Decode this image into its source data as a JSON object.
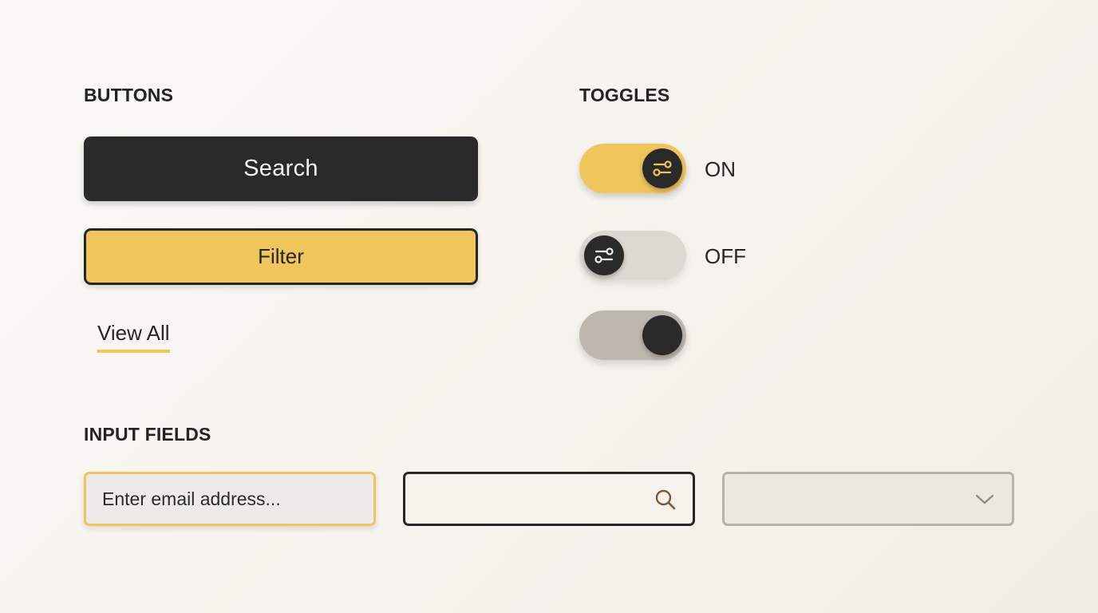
{
  "sections": {
    "buttons_title": "BUTTONS",
    "toggles_title": "TOGGLES",
    "inputs_title": "INPUT FIELDS"
  },
  "buttons": {
    "search_label": "Search",
    "filter_label": "Filter",
    "view_all_label": "View All"
  },
  "toggles": [
    {
      "state": "on",
      "label": "ON",
      "icon": "sliders-icon"
    },
    {
      "state": "off",
      "label": "OFF",
      "icon": "sliders-icon"
    },
    {
      "state": "on",
      "label": ""
    }
  ],
  "inputs": {
    "email_placeholder": "Enter email address...",
    "email_value": "",
    "search_value": "",
    "search_icon": "search-icon",
    "select_value": "",
    "select_icon": "chevron-down-icon"
  },
  "colors": {
    "accent_yellow": "#efc55c",
    "dark": "#2a2a2a",
    "background": "#f7f4ef",
    "toggle_off_track": "#ddd8d2",
    "toggle_third_track": "#bdb7af",
    "select_border": "#b8b3ac"
  }
}
